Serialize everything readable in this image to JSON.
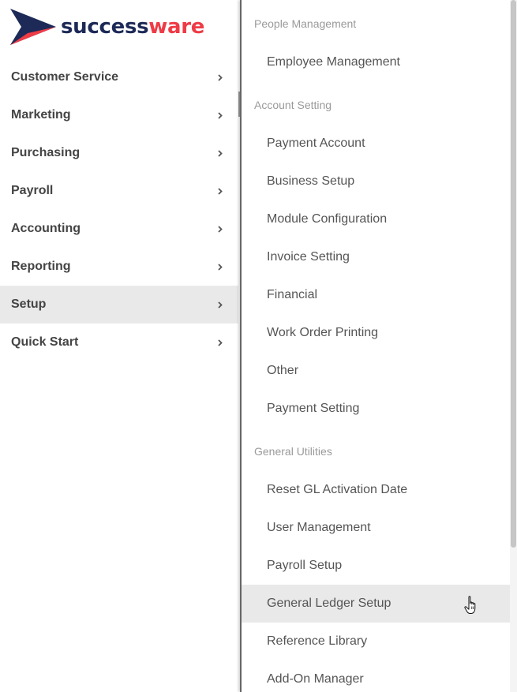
{
  "logo": {
    "text_a": "success",
    "text_b": "ware",
    "colors": {
      "navy": "#1d2a57",
      "red": "#ee3b46"
    }
  },
  "sidebar": {
    "items": [
      {
        "label": "Customer Service",
        "active": false
      },
      {
        "label": "Marketing",
        "active": false
      },
      {
        "label": "Purchasing",
        "active": false
      },
      {
        "label": "Payroll",
        "active": false
      },
      {
        "label": "Accounting",
        "active": false
      },
      {
        "label": "Reporting",
        "active": false
      },
      {
        "label": "Setup",
        "active": true
      },
      {
        "label": "Quick Start",
        "active": false
      }
    ],
    "chevron_icon": "chevron-right-icon"
  },
  "submenu": {
    "sections": [
      {
        "title": "People Management",
        "items": [
          "Employee Management"
        ]
      },
      {
        "title": "Account Setting",
        "items": [
          "Payment Account",
          "Business Setup",
          "Module Configuration",
          "Invoice Setting",
          "Financial",
          "Work Order Printing",
          "Other",
          "Payment Setting"
        ]
      },
      {
        "title": "General Utilities",
        "items": [
          "Reset GL Activation Date",
          "User Management",
          "Payroll Setup",
          "General Ledger Setup",
          "Reference Library",
          "Add-On Manager"
        ]
      }
    ],
    "hovered_item": "General Ledger Setup",
    "cursor_icon": "hand-pointer-icon"
  },
  "colors": {
    "active_bg": "#e9e9e9",
    "nav_text": "#444444",
    "section_text": "#9a9a9a",
    "item_text": "#555555"
  }
}
